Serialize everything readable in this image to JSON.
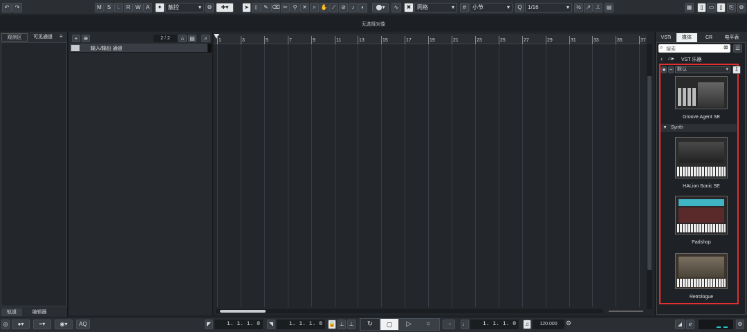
{
  "toolbar": {
    "undo_icon": "undo-icon",
    "redo_icon": "redo-icon",
    "mode_buttons": [
      "M",
      "S",
      "L",
      "R",
      "W",
      "A"
    ],
    "automation_mode": "触控",
    "snap_type": "网格",
    "grid_type": "小节",
    "quantize": "1/16"
  },
  "status": {
    "no_selection": "无选择对象"
  },
  "left_zone": {
    "tab_inspector": "观测区",
    "tab_visibility": "可见通道",
    "tab_track": "轨道",
    "tab_editor": "编辑器"
  },
  "track_list": {
    "count": "2 / 2",
    "folder_label": "输入/输出 通道"
  },
  "ruler": {
    "bars": [
      "1",
      "3",
      "5",
      "7",
      "9",
      "11",
      "13",
      "15",
      "17",
      "19",
      "21",
      "23",
      "25",
      "27",
      "29",
      "31",
      "33",
      "35",
      "37"
    ]
  },
  "right_zone": {
    "tabs": [
      "VSTi",
      "媒体",
      "CR",
      "电平表"
    ],
    "active_tab": "媒体",
    "search_placeholder": "搜索",
    "breadcrumb": "VST 乐器",
    "preset_filter": "默认",
    "category_synth": "Synth",
    "instruments": [
      "Groove Agent SE",
      "HALion Sonic SE",
      "Padshop",
      "Retrologue"
    ]
  },
  "transport": {
    "left_locator": "1. 1. 1.   0",
    "right_locator": "1. 1. 1.   0",
    "position": "1. 1. 1.   0",
    "tempo": "120.000",
    "aq_label": "AQ"
  },
  "colors": {
    "accent": "#e03030",
    "bg": "#1f2226",
    "active_tab": "#ffffff"
  }
}
